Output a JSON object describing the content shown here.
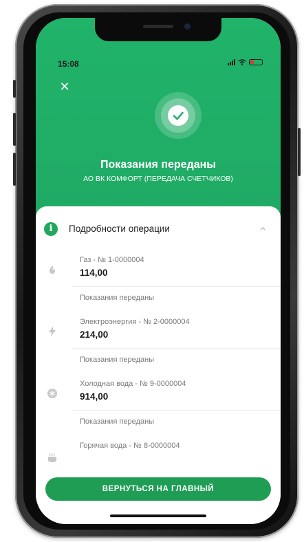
{
  "status_bar": {
    "time": "15:08"
  },
  "header": {
    "close_icon": "close-icon",
    "success_icon": "check-icon",
    "title": "Показания переданы",
    "subtitle": "АО ВК КОМФОРТ (ПЕРЕДАЧА СЧЕТЧИКОВ)"
  },
  "details": {
    "section_title": "Подробности операции",
    "items": [
      {
        "icon": "flame-icon",
        "label": "Газ - № 1-0000004",
        "value": "114,00",
        "status": "Показания переданы"
      },
      {
        "icon": "lightning-icon",
        "label": "Электроэнергия - № 2-0000004",
        "value": "214,00",
        "status": "Показания переданы"
      },
      {
        "icon": "snowflake-icon",
        "label": "Холодная вода - № 9-0000004",
        "value": "914,00",
        "status": "Показания переданы"
      },
      {
        "icon": "hot-water-icon",
        "label": "Горячая вода - № 8-0000004"
      }
    ]
  },
  "actions": {
    "return_home_label": "ВЕРНУТЬСЯ НА ГЛАВНЫЙ"
  },
  "colors": {
    "accent": "#21b36a",
    "button": "#1f9d55"
  }
}
